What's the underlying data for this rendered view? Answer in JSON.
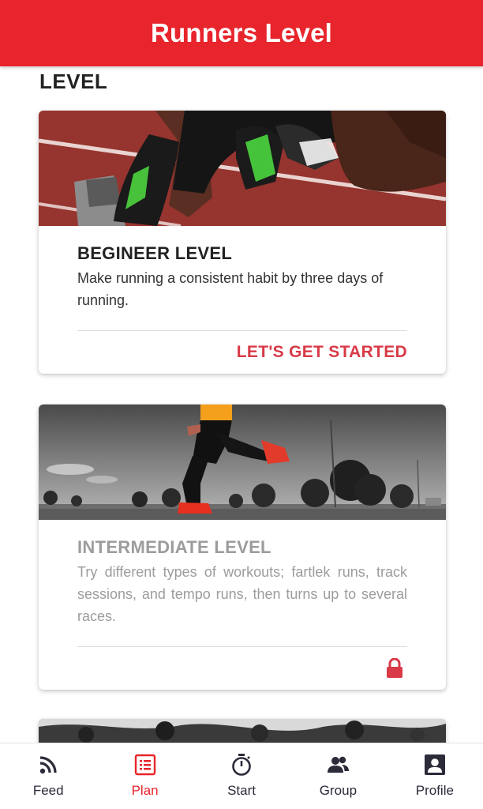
{
  "header": {
    "title": "Runners Level"
  },
  "section": {
    "title": "LEVEL"
  },
  "levels": [
    {
      "title": "BEGINEER LEVEL",
      "description": "Make running a consistent habit by three days of running.",
      "action_label": "LET'S GET STARTED",
      "locked": false
    },
    {
      "title": "INTERMEDIATE LEVEL",
      "description": "Try different types of workouts; fartlek runs, track sessions, and tempo runs, then turns up to several races.",
      "locked": true,
      "action_icon": "lock-icon"
    }
  ],
  "nav": {
    "active": "Plan",
    "items": [
      {
        "label": "Feed",
        "icon": "rss-feed-icon"
      },
      {
        "label": "Plan",
        "icon": "list-icon"
      },
      {
        "label": "Start",
        "icon": "stopwatch-icon"
      },
      {
        "label": "Group",
        "icon": "group-icon"
      },
      {
        "label": "Profile",
        "icon": "profile-icon"
      }
    ]
  },
  "colors": {
    "brand": "#e8242c",
    "accent": "#d93a48",
    "muted_text": "#9c9c9c"
  }
}
